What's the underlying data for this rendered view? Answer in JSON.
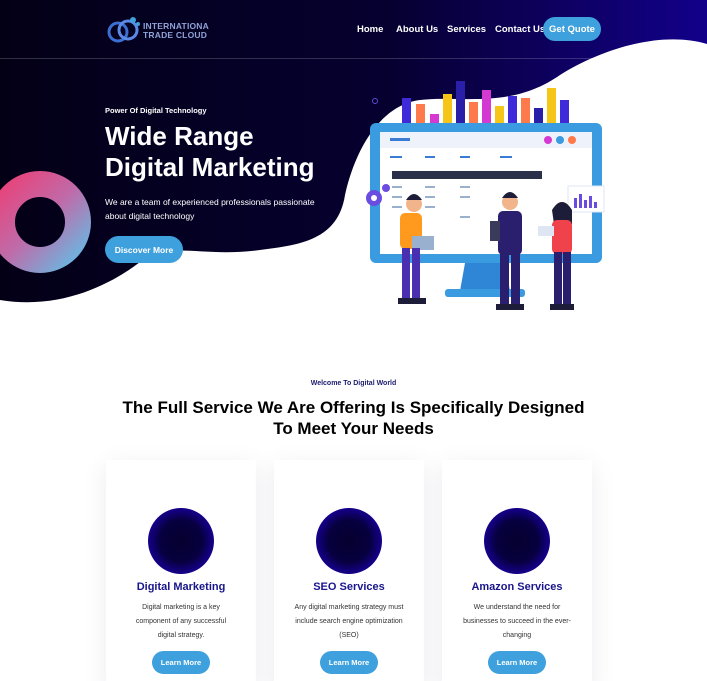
{
  "brand": {
    "logo_line1": "INTERNATIONA",
    "logo_line2": "TRADE CLOUD"
  },
  "nav": {
    "items": [
      {
        "label": "Home"
      },
      {
        "label": "About Us"
      },
      {
        "label": "Services"
      },
      {
        "label": "Contact Us"
      }
    ],
    "cta_label": "Get Quote"
  },
  "hero": {
    "eyebrow": "Power Of Digital Technology",
    "title_line1": "Wide Range",
    "title_line2": "Digital Marketing",
    "subtitle": "We are a team of experienced professionals passionate about digital technology",
    "button_label": "Discover More"
  },
  "services": {
    "eyebrow": "Welcome To Digital World",
    "title_line1": "The Full Service We Are Offering Is Specifically Designed",
    "title_line2": "To Meet Your Needs",
    "cards": [
      {
        "title": "Digital Marketing",
        "text": "Digital marketing is a key component of any successful digital strategy.",
        "button_label": "Learn More"
      },
      {
        "title": "SEO Services",
        "text": "Any digital marketing strategy must include search engine optimization (SEO)",
        "button_label": "Learn More"
      },
      {
        "title": "Amazon Services",
        "text": "We understand the need for businesses to succeed in the ever-changing",
        "button_label": "Learn More"
      }
    ]
  },
  "colors": {
    "hero_dark": "#05001f",
    "hero_navy": "#12007a",
    "accent_blue": "#3ea0dc",
    "card_title": "#19158c"
  }
}
